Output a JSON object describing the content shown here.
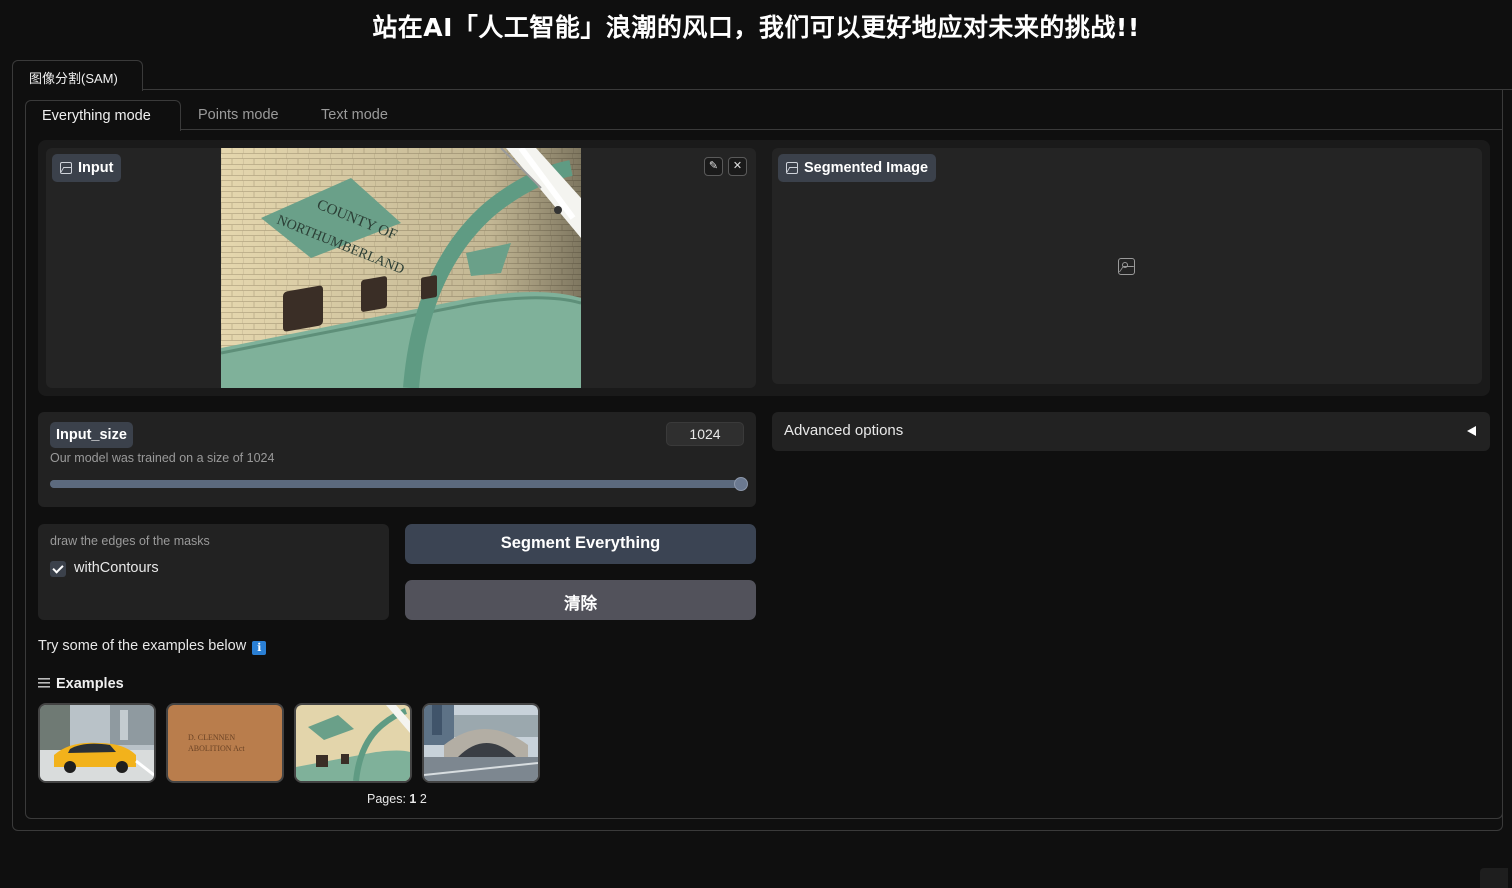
{
  "header": {
    "title": "站在AI「人工智能」浪潮的风口，我们可以更好地应对未来的挑战!!"
  },
  "outer_tabs": [
    {
      "label": "图像分割(SAM)",
      "active": true
    }
  ],
  "mode_tabs": [
    {
      "label": "Everything mode",
      "active": true
    },
    {
      "label": "Points mode",
      "active": false
    },
    {
      "label": "Text mode",
      "active": false
    }
  ],
  "input_image": {
    "label": "Input",
    "sign_line1": "COUNTY OF",
    "sign_line2": "NORTHUMBERLAND",
    "edit_icon": "pencil-icon",
    "clear_icon": "close-icon"
  },
  "output_image": {
    "label": "Segmented Image",
    "placeholder_icon": "image-icon"
  },
  "input_size": {
    "label": "Input_size",
    "value": "1024",
    "info": "Our model was trained on a size of 1024",
    "slider_fraction": 1.0
  },
  "contours": {
    "info": "draw the edges of the masks",
    "label": "withContours",
    "checked": true
  },
  "buttons": {
    "segment": "Segment Everything",
    "clear": "清除"
  },
  "advanced": {
    "label": "Advanced options",
    "collapsed": true
  },
  "examples": {
    "hint": "Try some of the examples below",
    "hint_emoji": "ℹ",
    "title": "Examples",
    "thumb2_line1": "D. CLENNEN",
    "thumb2_line2": "ABOLITION Act",
    "pages_label": "Pages:",
    "current_page": "1",
    "other_page": "2"
  },
  "colors": {
    "background": "#0f0f0f",
    "panel": "#222222",
    "badge": "#3b414b",
    "primary_button": "#3b4453",
    "secondary_button": "#52525b"
  }
}
